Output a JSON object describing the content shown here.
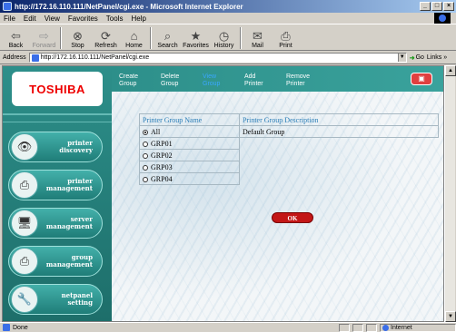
{
  "window": {
    "title": "http://172.16.110.111/NetPanel/cgi.exe - Microsoft Internet Explorer",
    "buttons": [
      "_",
      "□",
      "×"
    ]
  },
  "menu": [
    "File",
    "Edit",
    "View",
    "Favorites",
    "Tools",
    "Help"
  ],
  "toolbar": [
    {
      "label": "Back",
      "icon": "back-arrow-icon",
      "glyph": "⇦",
      "disabled": false
    },
    {
      "label": "Forward",
      "icon": "forward-arrow-icon",
      "glyph": "⇨",
      "disabled": true
    },
    {
      "label": "Stop",
      "icon": "stop-icon",
      "glyph": "⊗",
      "disabled": false
    },
    {
      "label": "Refresh",
      "icon": "refresh-icon",
      "glyph": "⟳",
      "disabled": false
    },
    {
      "label": "Home",
      "icon": "home-icon",
      "glyph": "⌂",
      "disabled": false
    },
    {
      "label": "Search",
      "icon": "search-icon",
      "glyph": "⌕",
      "disabled": false
    },
    {
      "label": "Favorites",
      "icon": "favorites-icon",
      "glyph": "★",
      "disabled": false
    },
    {
      "label": "History",
      "icon": "history-icon",
      "glyph": "◷",
      "disabled": false
    },
    {
      "label": "Mail",
      "icon": "mail-icon",
      "glyph": "✉",
      "disabled": false
    },
    {
      "label": "Print",
      "icon": "print-icon",
      "glyph": "⎙",
      "disabled": false
    }
  ],
  "address": {
    "label": "Address",
    "url": "http://172.16.110.111/NetPanel/cgi.exe",
    "go": "Go",
    "links": "Links »"
  },
  "brand": {
    "logo": "TOSHIBA",
    "logo_color": "#e00000"
  },
  "sidenav": [
    {
      "label": "printer\ndiscovery",
      "icon": "binoculars-icon",
      "glyph": "👁"
    },
    {
      "label": "printer\nmanagement",
      "icon": "printer-icon",
      "glyph": "⎙"
    },
    {
      "label": "server\nmanagement",
      "icon": "server-icon",
      "glyph": "🖥"
    },
    {
      "label": "group\nmanagement",
      "icon": "group-icon",
      "glyph": "⎙"
    },
    {
      "label": "netpanel\nsetting",
      "icon": "wrench-icon",
      "glyph": "🔧"
    }
  ],
  "topnav": [
    {
      "label": "Create\nGroup",
      "active": false
    },
    {
      "label": "Delete\nGroup",
      "active": false
    },
    {
      "label": "View\nGroup",
      "active": true
    },
    {
      "label": "Add\nPrinter",
      "active": false
    },
    {
      "label": "Remove\nPrinter",
      "active": false
    }
  ],
  "table": {
    "headers": [
      "Printer Group Name",
      "Printer Group Description"
    ],
    "rows": [
      {
        "name": "All",
        "description": "Default Group",
        "selected": true
      },
      {
        "name": "GRP01",
        "description": "",
        "selected": false
      },
      {
        "name": "GRP02",
        "description": "",
        "selected": false
      },
      {
        "name": "GRP03",
        "description": "",
        "selected": false
      },
      {
        "name": "GRP04",
        "description": "",
        "selected": false
      }
    ]
  },
  "ok_label": "OK",
  "status": {
    "text": "Done",
    "zone": "Internet"
  }
}
